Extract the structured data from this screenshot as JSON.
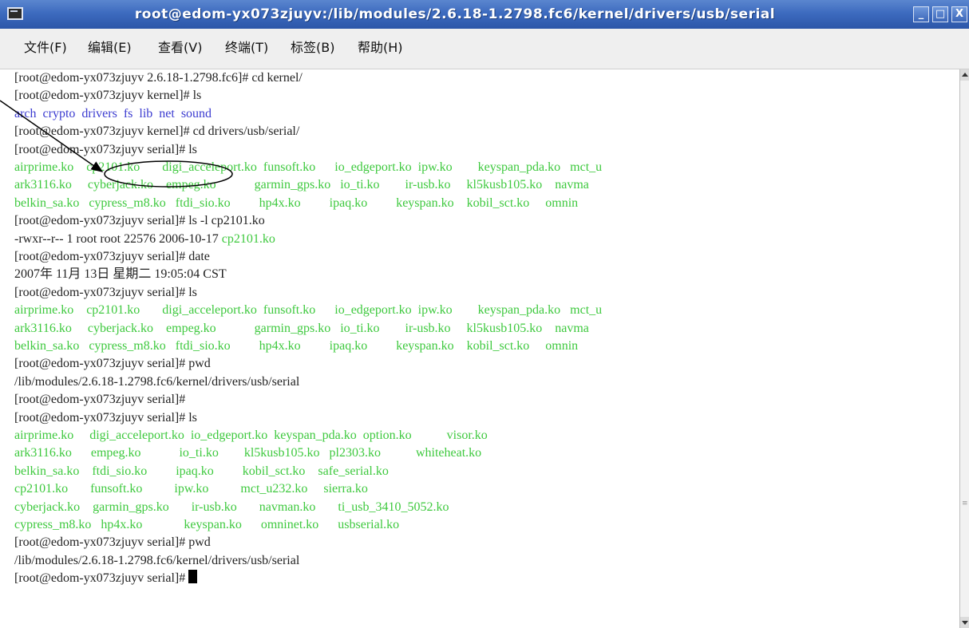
{
  "window": {
    "title": "root@edom-yx073zjuyv:/lib/modules/2.6.18-1.2798.fc6/kernel/drivers/usb/serial",
    "buttons": {
      "minimize": "_",
      "maximize": "□",
      "close": "X"
    }
  },
  "menu": [
    "文件(F)",
    "编辑(E)",
    "查看(V)",
    "终端(T)",
    "标签(B)",
    "帮助(H)"
  ],
  "terminal": {
    "lines": [
      [
        {
          "t": "[root@edom-yx073zjuyv 2.6.18-1.2798.fc6]# cd kernel/",
          "c": "n"
        }
      ],
      [
        {
          "t": "[root@edom-yx073zjuyv kernel]# ls",
          "c": "n"
        }
      ],
      [
        {
          "t": "arch  crypto  drivers  fs  lib  net  sound",
          "c": "b"
        }
      ],
      [
        {
          "t": "[root@edom-yx073zjuyv kernel]# cd drivers/usb/serial/",
          "c": "n"
        }
      ],
      [
        {
          "t": "[root@edom-yx073zjuyv serial]# ls",
          "c": "n"
        }
      ],
      [
        {
          "t": "airprime.ko    cp2101.ko       digi_acceleport.ko  funsoft.ko      io_edgeport.ko  ipw.ko        keyspan_pda.ko   mct_u",
          "c": "g"
        }
      ],
      [
        {
          "t": "ark3116.ko     cyberjack.ko    empeg.ko            garmin_gps.ko   io_ti.ko        ir-usb.ko     kl5kusb105.ko    navma",
          "c": "g"
        }
      ],
      [
        {
          "t": "belkin_sa.ko   cypress_m8.ko   ftdi_sio.ko         hp4x.ko         ipaq.ko         keyspan.ko    kobil_sct.ko     omnin",
          "c": "g"
        }
      ],
      [
        {
          "t": "[root@edom-yx073zjuyv serial]# ls -l cp2101.ko",
          "c": "n"
        }
      ],
      [
        {
          "t": "-rwxr--r-- 1 root root 22576 2006-10-17 ",
          "c": "n"
        },
        {
          "t": "cp2101.ko",
          "c": "g"
        }
      ],
      [
        {
          "t": "[root@edom-yx073zjuyv serial]# date",
          "c": "n"
        }
      ],
      [
        {
          "t": "2007年 11月 13日 星期二 19:05:04 CST",
          "c": "n"
        }
      ],
      [
        {
          "t": "[root@edom-yx073zjuyv serial]# ls",
          "c": "n"
        }
      ],
      [
        {
          "t": "airprime.ko    cp2101.ko       digi_acceleport.ko  funsoft.ko      io_edgeport.ko  ipw.ko        keyspan_pda.ko   mct_u",
          "c": "g"
        }
      ],
      [
        {
          "t": "ark3116.ko     cyberjack.ko    empeg.ko            garmin_gps.ko   io_ti.ko        ir-usb.ko     kl5kusb105.ko    navma",
          "c": "g"
        }
      ],
      [
        {
          "t": "belkin_sa.ko   cypress_m8.ko   ftdi_sio.ko         hp4x.ko         ipaq.ko         keyspan.ko    kobil_sct.ko     omnin",
          "c": "g"
        }
      ],
      [
        {
          "t": "[root@edom-yx073zjuyv serial]# pwd",
          "c": "n"
        }
      ],
      [
        {
          "t": "/lib/modules/2.6.18-1.2798.fc6/kernel/drivers/usb/serial",
          "c": "n"
        }
      ],
      [
        {
          "t": "[root@edom-yx073zjuyv serial]#",
          "c": "n"
        }
      ],
      [
        {
          "t": "[root@edom-yx073zjuyv serial]# ls",
          "c": "n"
        }
      ],
      [
        {
          "t": "airprime.ko     digi_acceleport.ko  io_edgeport.ko  keyspan_pda.ko  option.ko           visor.ko",
          "c": "g"
        }
      ],
      [
        {
          "t": "ark3116.ko      empeg.ko            io_ti.ko        kl5kusb105.ko   pl2303.ko           whiteheat.ko",
          "c": "g"
        }
      ],
      [
        {
          "t": "belkin_sa.ko    ftdi_sio.ko         ipaq.ko         kobil_sct.ko    safe_serial.ko",
          "c": "g"
        }
      ],
      [
        {
          "t": "cp2101.ko       funsoft.ko          ipw.ko          mct_u232.ko     sierra.ko",
          "c": "g"
        }
      ],
      [
        {
          "t": "cyberjack.ko    garmin_gps.ko       ir-usb.ko       navman.ko       ti_usb_3410_5052.ko",
          "c": "g"
        }
      ],
      [
        {
          "t": "cypress_m8.ko   hp4x.ko             keyspan.ko      omninet.ko      usbserial.ko",
          "c": "g"
        }
      ],
      [
        {
          "t": "[root@edom-yx073zjuyv serial]# pwd",
          "c": "n"
        }
      ],
      [
        {
          "t": "/lib/modules/2.6.18-1.2798.fc6/kernel/drivers/usb/serial",
          "c": "n"
        }
      ],
      [
        {
          "t": "[root@edom-yx073zjuyv serial]# ",
          "c": "n"
        }
      ]
    ]
  },
  "colors": {
    "titlebar": "#3d6bbf",
    "module_text": "#3ec93e",
    "directory_text": "#3b3bd0",
    "plain_text": "#222222",
    "annotation": "#000000"
  },
  "icons": {
    "app": "terminal-icon",
    "annotation": "arrow-pointer-to-ellipse"
  }
}
